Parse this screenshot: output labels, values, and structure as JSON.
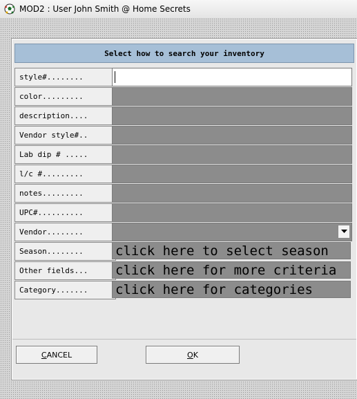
{
  "window": {
    "title": "MOD2 : User John Smith @ Home Secrets",
    "icon": "soccer-ball-icon"
  },
  "dialog": {
    "header": "Select how to search your inventory",
    "rows": [
      {
        "label": "style#........",
        "value": "",
        "type": "text-active"
      },
      {
        "label": "color.........",
        "value": "",
        "type": "text"
      },
      {
        "label": "description....",
        "value": "",
        "type": "text"
      },
      {
        "label": "Vendor style#..",
        "value": "",
        "type": "text"
      },
      {
        "label": "Lab dip # .....",
        "value": "",
        "type": "text"
      },
      {
        "label": "l/c #.........",
        "value": "",
        "type": "text"
      },
      {
        "label": "notes.........",
        "value": "",
        "type": "text"
      },
      {
        "label": "UPC#..........",
        "value": "",
        "type": "text"
      },
      {
        "label": "Vendor........",
        "value": "",
        "type": "dropdown",
        "icon": "chevron-down-icon"
      },
      {
        "label": "Season........",
        "value": "click here to select season",
        "type": "action"
      },
      {
        "label": "Other fields...",
        "value": "click here for more criteria",
        "type": "action"
      },
      {
        "label": "Category.......",
        "value": "click here for categories",
        "type": "action"
      }
    ],
    "buttons": {
      "cancel": {
        "mnemonic": "C",
        "rest": "ANCEL"
      },
      "ok": {
        "mnemonic": "O",
        "rest": "K"
      }
    }
  },
  "colors": {
    "header_bg": "#a6bfd7",
    "field_disabled": "#8c8c8c",
    "field_active": "#ffffff"
  }
}
